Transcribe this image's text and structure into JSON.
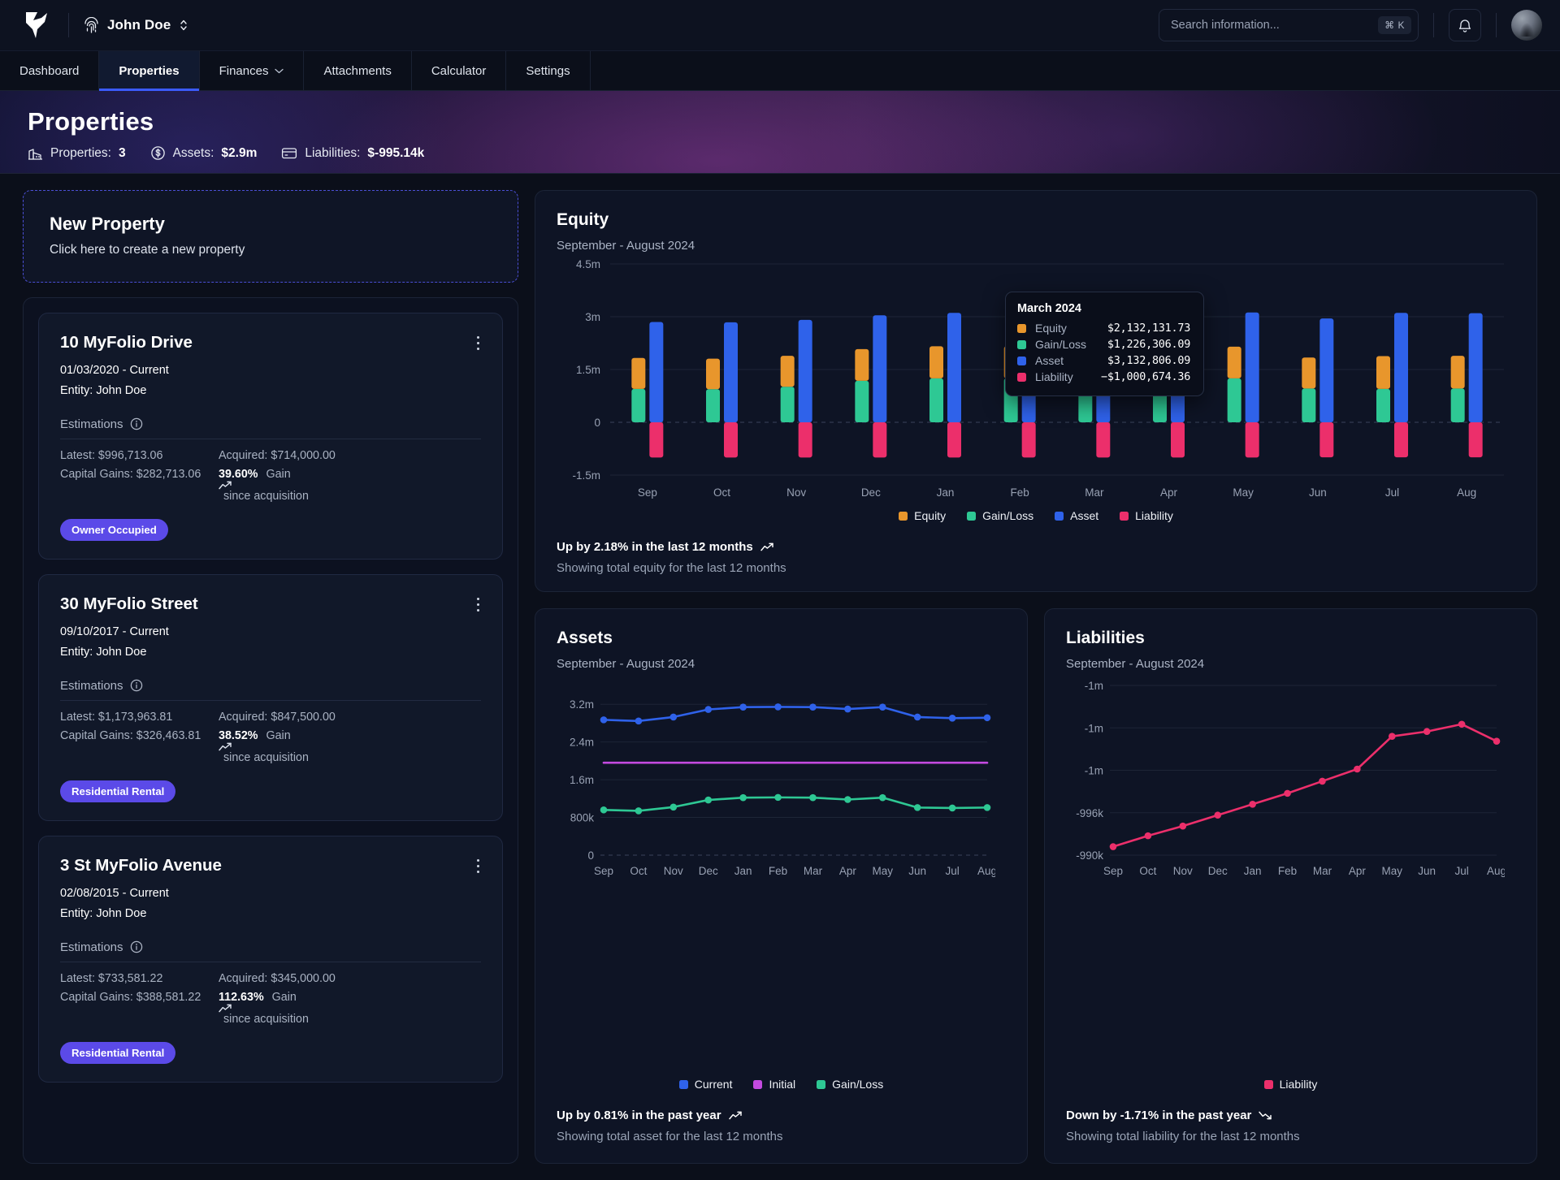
{
  "topbar": {
    "logo_icon": "bird-logo-icon",
    "user_name": "John Doe",
    "user_icon": "fingerprint-icon",
    "user_chevron_icon": "chevron-updown-icon",
    "search_placeholder": "Search information...",
    "search_value": "",
    "search_shortcut": "⌘ K",
    "bell_icon": "bell-icon",
    "avatar_name": "avatar"
  },
  "nav": {
    "tabs": [
      {
        "label": "Dashboard",
        "active": false,
        "has_caret": false
      },
      {
        "label": "Properties",
        "active": true,
        "has_caret": false
      },
      {
        "label": "Finances",
        "active": false,
        "has_caret": true
      },
      {
        "label": "Attachments",
        "active": false,
        "has_caret": false
      },
      {
        "label": "Calculator",
        "active": false,
        "has_caret": false
      },
      {
        "label": "Settings",
        "active": false,
        "has_caret": false
      }
    ]
  },
  "header": {
    "title": "Properties",
    "stats": [
      {
        "icon": "building-icon",
        "label": "Properties:",
        "value": "3"
      },
      {
        "icon": "dollar-circle-icon",
        "label": "Assets:",
        "value": "$2.9m"
      },
      {
        "icon": "card-icon",
        "label": "Liabilities:",
        "value": "$-995.14k"
      }
    ]
  },
  "new_property": {
    "title": "New Property",
    "subtitle": "Click here to create a new property"
  },
  "properties": [
    {
      "name": "10 MyFolio Drive",
      "period": "01/03/2020 - Current",
      "entity": "Entity: John Doe",
      "estimations_label": "Estimations",
      "latest": "Latest: $996,713.06",
      "acquired": "Acquired: $714,000.00",
      "capital_gains": "Capital Gains: $282,713.06",
      "gain_pct": "39.60%",
      "gain_word": "Gain",
      "gain_suffix": "since acquisition",
      "tag": "Owner Occupied"
    },
    {
      "name": "30 MyFolio Street",
      "period": "09/10/2017 - Current",
      "entity": "Entity: John Doe",
      "estimations_label": "Estimations",
      "latest": "Latest: $1,173,963.81",
      "acquired": "Acquired: $847,500.00",
      "capital_gains": "Capital Gains: $326,463.81",
      "gain_pct": "38.52%",
      "gain_word": "Gain",
      "gain_suffix": "since acquisition",
      "tag": "Residential Rental"
    },
    {
      "name": "3 St MyFolio Avenue",
      "period": "02/08/2015 - Current",
      "entity": "Entity: John Doe",
      "estimations_label": "Estimations",
      "latest": "Latest: $733,581.22",
      "acquired": "Acquired: $345,000.00",
      "capital_gains": "Capital Gains: $388,581.22",
      "gain_pct": "112.63%",
      "gain_word": "Gain",
      "gain_suffix": "since acquisition",
      "tag": "Residential Rental"
    }
  ],
  "colors": {
    "equity": "#e8962c",
    "gainloss": "#2ec894",
    "asset": "#2f62ea",
    "liability": "#ec2f6b",
    "initial": "#c44ae0",
    "accent": "#5b4ae8",
    "tab_underline": "#3b5bfd"
  },
  "equity_card": {
    "title": "Equity",
    "subtitle": "September - August 2024",
    "footer_strong": "Up by 2.18% in the last 12 months",
    "footer_trend_icon": "trend-up-icon",
    "footer_sub": "Showing total equity for the last 12 months",
    "tooltip": {
      "title": "March 2024",
      "rows": [
        {
          "label": "Equity",
          "value": "$2,132,131.73",
          "color_key": "equity"
        },
        {
          "label": "Gain/Loss",
          "value": "$1,226,306.09",
          "color_key": "gainloss"
        },
        {
          "label": "Asset",
          "value": "$3,132,806.09",
          "color_key": "asset"
        },
        {
          "label": "Liability",
          "value": "−$1,000,674.36",
          "color_key": "liability"
        }
      ]
    }
  },
  "assets_card": {
    "title": "Assets",
    "subtitle": "September - August 2024",
    "footer_strong": "Up by 0.81% in the past year",
    "footer_trend_icon": "trend-up-icon",
    "footer_sub": "Showing total asset for the last 12 months"
  },
  "liabilities_card": {
    "title": "Liabilities",
    "subtitle": "September - August 2024",
    "footer_strong": "Down by -1.71% in the past year",
    "footer_trend_icon": "trend-down-icon",
    "footer_sub": "Showing total liability for the last 12 months"
  },
  "chart_data": [
    {
      "id": "equity",
      "type": "bar",
      "title": "Equity",
      "subtitle": "September - August 2024",
      "xlabel": "",
      "ylabel": "",
      "grid": true,
      "legend_position": "bottom",
      "categories": [
        "Sep",
        "Oct",
        "Nov",
        "Dec",
        "Jan",
        "Feb",
        "Mar",
        "Apr",
        "May",
        "Jun",
        "Jul",
        "Aug"
      ],
      "ylim": [
        -1500000,
        4500000
      ],
      "yticks": [
        -1500000,
        0,
        1500000,
        3000000,
        4500000
      ],
      "ytick_labels": [
        "-1.5m",
        "0",
        "1.5m",
        "3m",
        "4.5m"
      ],
      "note": "Per month a stacked bar (Gain/Loss bottom + Equity top) sits beside an Asset bar; Liability bars hang below zero.",
      "series": [
        {
          "name": "Gain/Loss",
          "color": "#2ec894",
          "stack": "equity",
          "values": [
            950000,
            940000,
            1010000,
            1180000,
            1250000,
            1250000,
            1226306,
            1210000,
            1250000,
            960000,
            950000,
            960000
          ]
        },
        {
          "name": "Equity",
          "color": "#e8962c",
          "stack": "equity",
          "values": [
            880000,
            870000,
            880000,
            900000,
            910000,
            910000,
            905826,
            900000,
            900000,
            880000,
            930000,
            930000
          ]
        },
        {
          "name": "Asset",
          "color": "#2f62ea",
          "stack": "asset",
          "values": [
            2850000,
            2840000,
            2910000,
            3040000,
            3110000,
            3110000,
            3132806,
            3080000,
            3120000,
            2950000,
            3110000,
            3100000
          ]
        },
        {
          "name": "Liability",
          "color": "#ec2f6b",
          "stack": "liability",
          "values": [
            -1000000,
            -1000000,
            -1000000,
            -1000000,
            -1000000,
            -1000000,
            -1000674,
            -1000000,
            -1000000,
            -995000,
            -995000,
            -995000
          ]
        }
      ]
    },
    {
      "id": "assets",
      "type": "line",
      "title": "Assets",
      "subtitle": "September - August 2024",
      "xlabel": "",
      "ylabel": "",
      "grid": true,
      "legend_position": "bottom",
      "categories": [
        "Sep",
        "Oct",
        "Nov",
        "Dec",
        "Jan",
        "Feb",
        "Mar",
        "Apr",
        "May",
        "Jun",
        "Jul",
        "Aug"
      ],
      "ylim": [
        0,
        3600000
      ],
      "yticks": [
        0,
        800000,
        1600000,
        2400000,
        3200000
      ],
      "ytick_labels": [
        "0",
        "800k",
        "1.6m",
        "2.4m",
        "3.2m"
      ],
      "series": [
        {
          "name": "Current",
          "color": "#2f62ea",
          "markers": true,
          "values": [
            2870000,
            2845000,
            2930000,
            3090000,
            3140000,
            3145000,
            3140000,
            3100000,
            3140000,
            2930000,
            2905000,
            2915000
          ]
        },
        {
          "name": "Initial",
          "color": "#c44ae0",
          "markers": false,
          "values": [
            1960000,
            1960000,
            1960000,
            1960000,
            1960000,
            1960000,
            1960000,
            1960000,
            1960000,
            1960000,
            1960000,
            1960000
          ]
        },
        {
          "name": "Gain/Loss",
          "color": "#2ec894",
          "markers": true,
          "values": [
            960000,
            940000,
            1020000,
            1170000,
            1220000,
            1225000,
            1220000,
            1180000,
            1220000,
            1010000,
            1000000,
            1010000
          ]
        }
      ]
    },
    {
      "id": "liabilities",
      "type": "line",
      "title": "Liabilities",
      "subtitle": "September - August 2024",
      "xlabel": "",
      "ylabel": "",
      "grid": true,
      "legend_position": "bottom",
      "categories": [
        "Sep",
        "Oct",
        "Nov",
        "Dec",
        "Jan",
        "Feb",
        "Mar",
        "Apr",
        "May",
        "Jun",
        "Jul",
        "Aug"
      ],
      "ylim": [
        -1012000,
        -998000
      ],
      "yticks": [
        -1012000,
        -1008500,
        -1005000,
        -1001500,
        -998000
      ],
      "ytick_labels": [
        "-990k",
        "-996k",
        "-1m",
        "-1m",
        "-1m"
      ],
      "series": [
        {
          "name": "Liability",
          "color": "#ec2f6b",
          "markers": true,
          "values": [
            -1011300,
            -1010400,
            -1009600,
            -1008700,
            -1007800,
            -1006900,
            -1005900,
            -1004900,
            -1002200,
            -1001800,
            -1001200,
            -1002600
          ]
        }
      ]
    }
  ],
  "equity_legend": [
    {
      "label": "Equity",
      "color_key": "equity"
    },
    {
      "label": "Gain/Loss",
      "color_key": "gainloss"
    },
    {
      "label": "Asset",
      "color_key": "asset"
    },
    {
      "label": "Liability",
      "color_key": "liability"
    }
  ],
  "assets_legend": [
    {
      "label": "Current",
      "color_key": "asset"
    },
    {
      "label": "Initial",
      "color_key": "initial"
    },
    {
      "label": "Gain/Loss",
      "color_key": "gainloss"
    }
  ],
  "liabilities_legend": [
    {
      "label": "Liability",
      "color_key": "liability"
    }
  ]
}
